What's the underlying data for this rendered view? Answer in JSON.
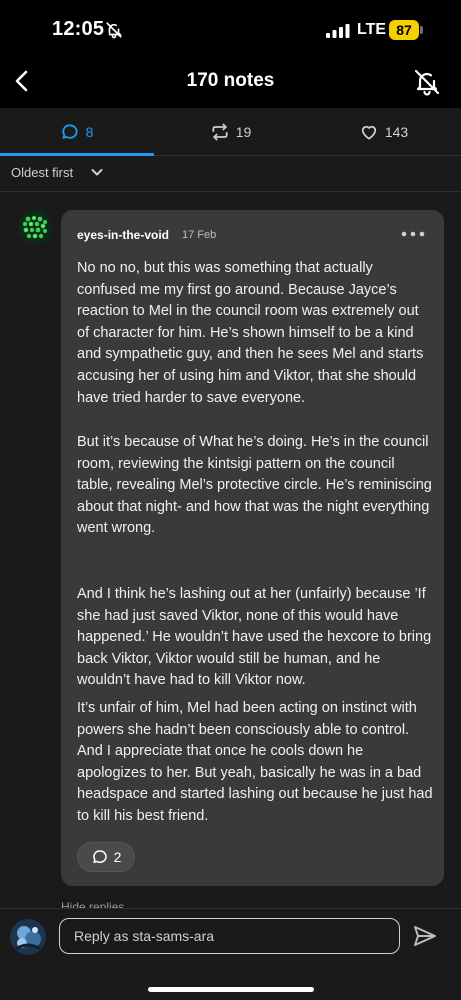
{
  "status_bar": {
    "time": "12:05",
    "network": "LTE",
    "battery": "87"
  },
  "nav": {
    "title": "170 notes"
  },
  "tabs": {
    "replies_count": "8",
    "reblogs_count": "19",
    "likes_count": "143",
    "active": "replies",
    "accent_color": "#1d9bf0"
  },
  "sort": {
    "label": "Oldest first"
  },
  "comment": {
    "username": "eyes-in-the-void",
    "date": "17 Feb",
    "paragraphs": [
      "No no no, but this was something that actually confused me my first go around. Because Jayce’s reaction to Mel in the council room was extremely out of character for him. He’s shown himself to be a kind and sympathetic guy, and then he sees Mel and starts accusing her of using him and Viktor, that she should have tried harder to save everyone.",
      "But it’s because of What he’s doing. He’s in the council room, reviewing the kintsigi pattern on the council table, revealing Mel’s protective circle. He’s reminiscing about that night- and how that was the night everything went wrong.",
      "And I think he’s lashing out at her (unfairly) because ’If she had just saved Viktor, none of this would have happened.’ He wouldn’t have used the hexcore to bring back Viktor, Viktor would still be human, and he wouldn’t have had to kill Viktor now.",
      "It’s unfair of him, Mel had been acting on instinct with powers she hadn’t been consciously able to control. And I appreciate that once he cools down he apologizes to her. But yeah, basically he was in a bad headspace and started lashing out because he just had to kill his best friend."
    ],
    "reply_count": "2"
  },
  "hide_replies": "Hide replies",
  "reply_bar": {
    "placeholder": "Reply as sta-sams-ara"
  }
}
